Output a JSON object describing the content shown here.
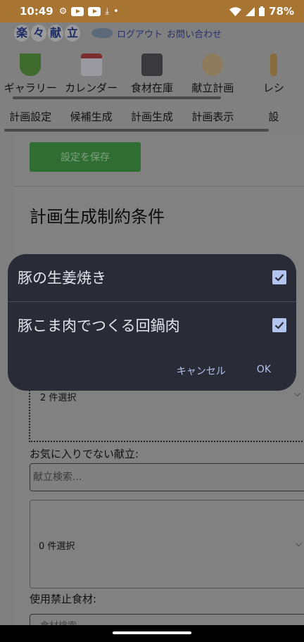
{
  "status_bar": {
    "time": "10:49",
    "battery": "78%"
  },
  "header": {
    "logo_chars": [
      "楽",
      "々",
      "献",
      "立"
    ],
    "logout_link": "ログアウト",
    "contact_link": "お問い合わせ"
  },
  "nav": {
    "items": [
      {
        "label": "ギャラリー",
        "icon": "salad-icon"
      },
      {
        "label": "カレンダー",
        "icon": "calendar-icon"
      },
      {
        "label": "食材在庫",
        "icon": "cabinet-icon"
      },
      {
        "label": "献立計画",
        "icon": "chef-icon"
      },
      {
        "label": "レシ",
        "icon": "scroll-icon"
      }
    ]
  },
  "subnav": {
    "items": [
      "計画設定",
      "候補生成",
      "計画生成",
      "計画表示",
      "設"
    ]
  },
  "content": {
    "save_button": "設定を保存",
    "section_title": "計画生成制約条件",
    "selected_count_1": "2 件選択",
    "unfavorite_label": "お気に入りでない献立:",
    "search_placeholder": "献立検索...",
    "selected_count_2": "0 件選択",
    "banned_label": "使用禁止食材:",
    "search2_placeholder": "食材検索"
  },
  "dialog": {
    "options": [
      {
        "label": "豚の生姜焼き",
        "checked": true
      },
      {
        "label": "豚こま肉でつくる回鍋肉",
        "checked": true
      }
    ],
    "cancel_label": "キャンセル",
    "ok_label": "OK"
  }
}
